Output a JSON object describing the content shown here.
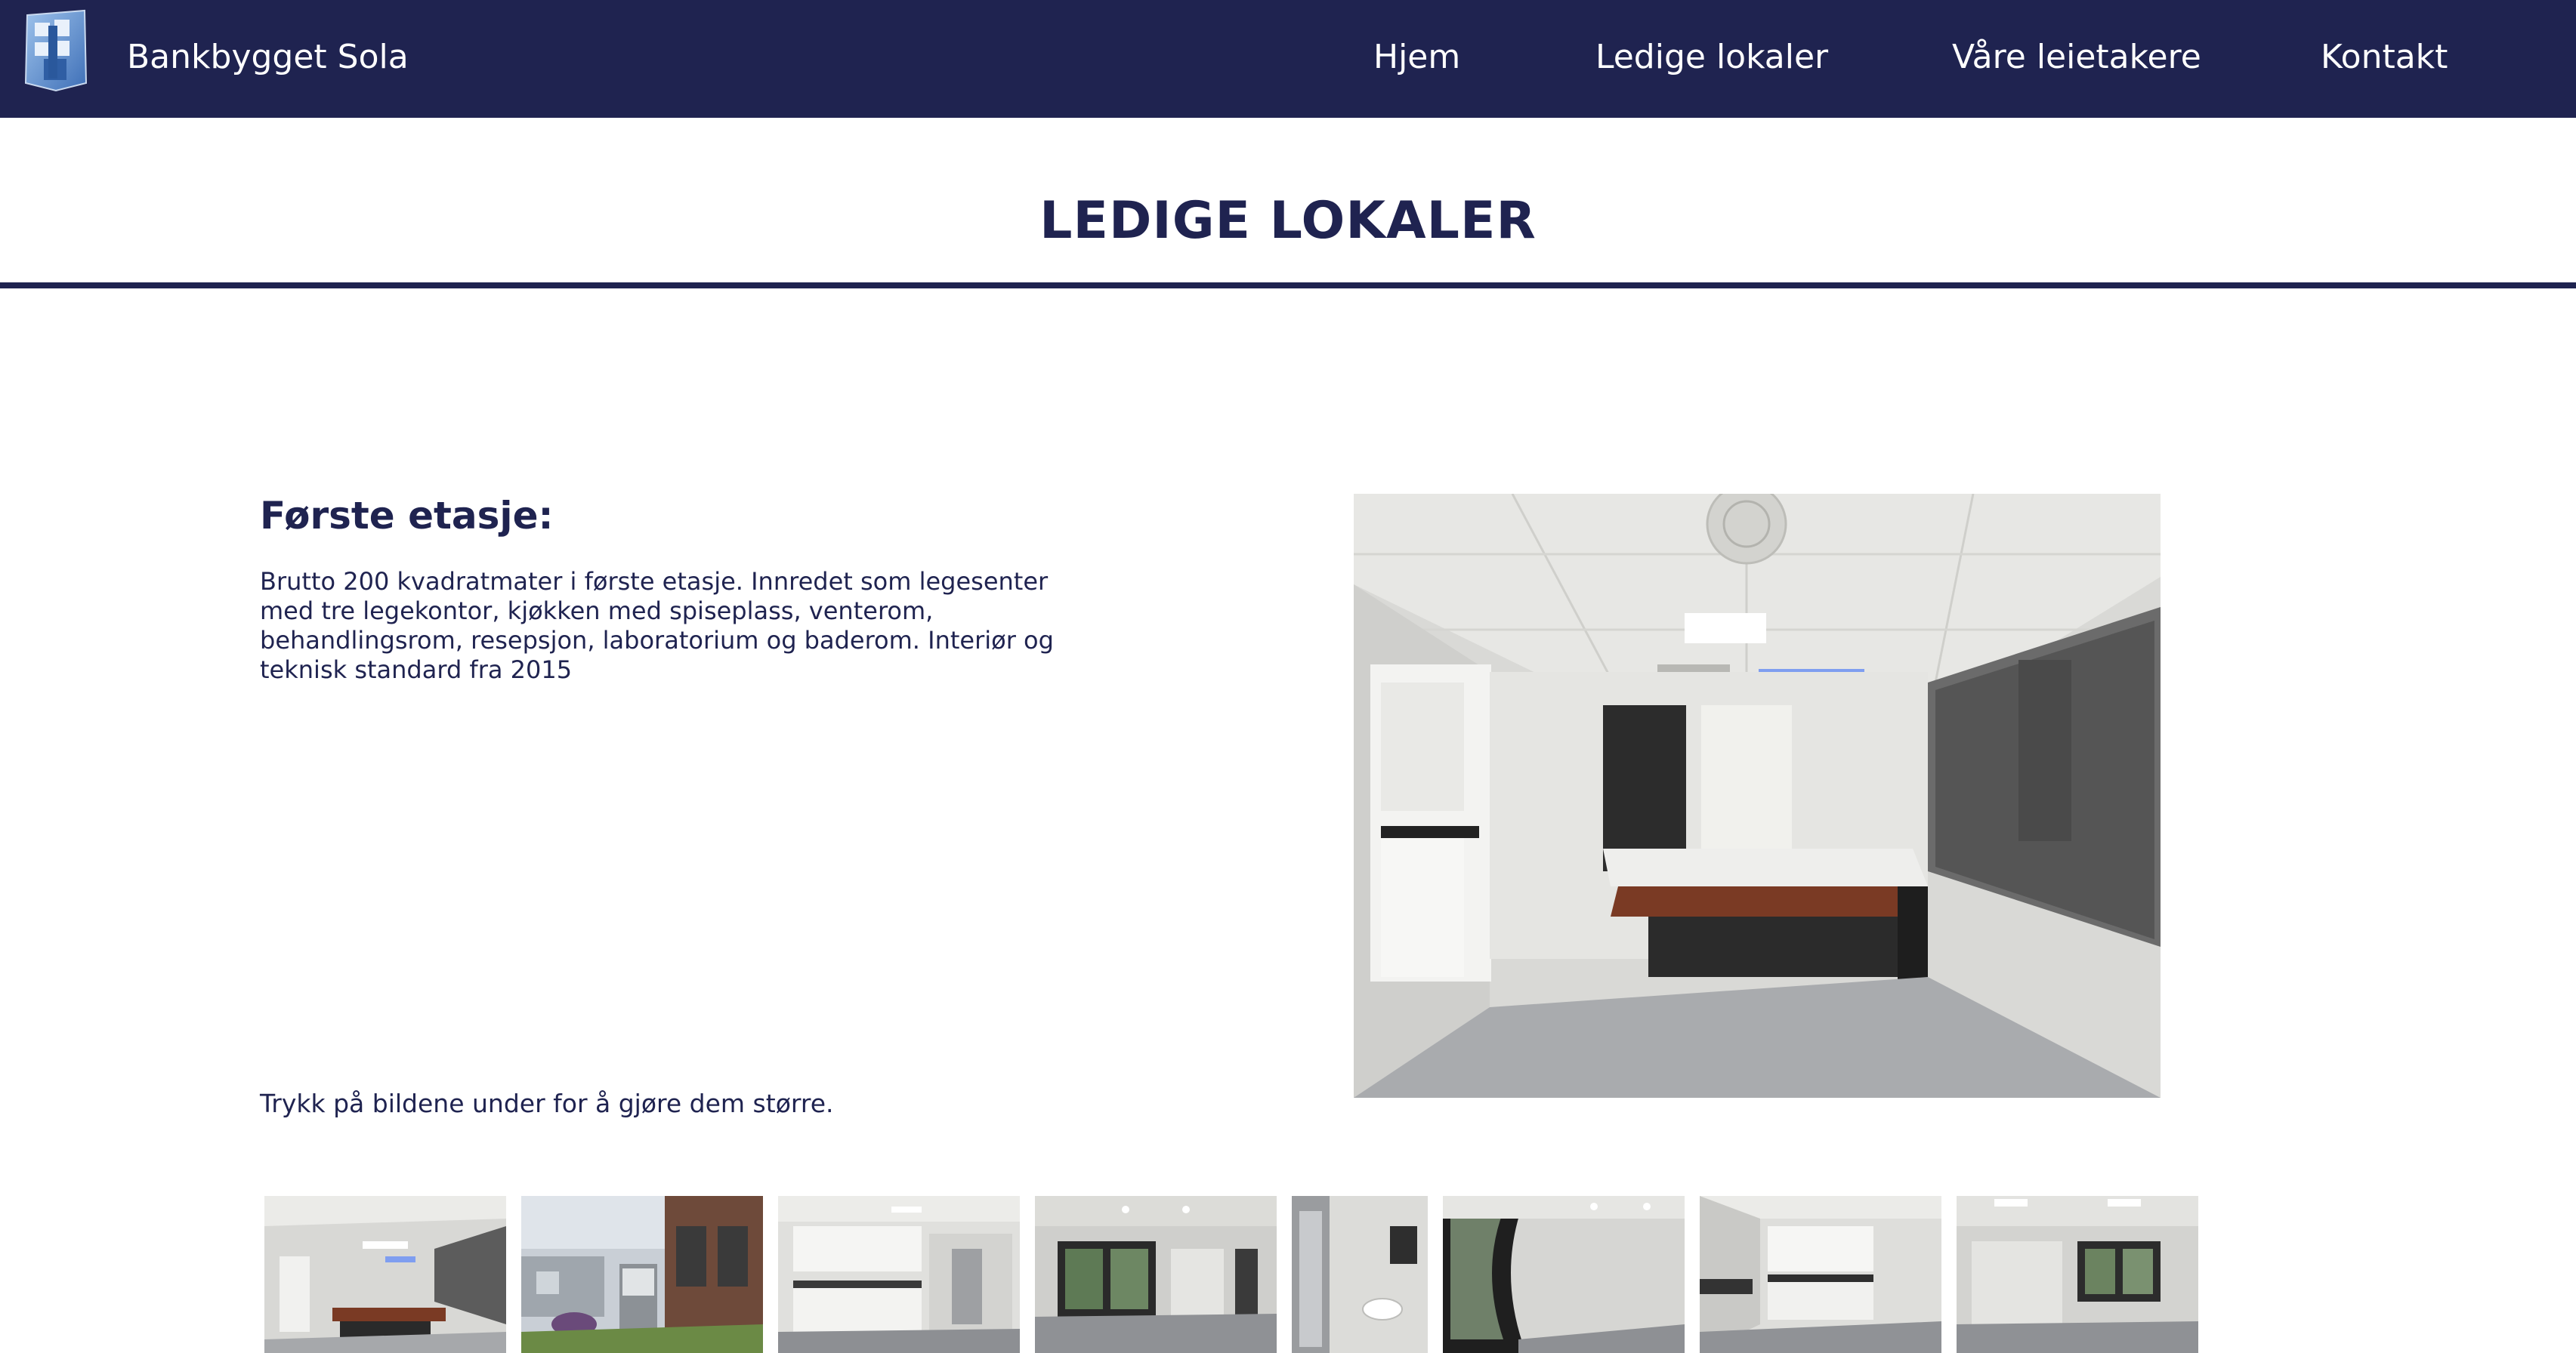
{
  "site": {
    "brand": "Bankbygget Sola"
  },
  "nav": {
    "items": [
      {
        "label": "Hjem"
      },
      {
        "label": "Ledige lokaler"
      },
      {
        "label": "Våre leietakere"
      },
      {
        "label": "Kontakt"
      }
    ]
  },
  "page": {
    "title": "LEDIGE LOKALER"
  },
  "section": {
    "heading": "Første etasje:",
    "description": "Brutto 200 kvadratmater i første etasje. Innredet som legesenter med tre legekontor, kjøkken med spiseplass, venterom, behandlingsrom, resepsjon, laboratorium og baderom. Interiør og teknisk standard fra 2015",
    "hint": "Trykk på bildene under for å gjøre dem større."
  },
  "colors": {
    "navy": "#1f2350",
    "white": "#ffffff"
  },
  "gallery": {
    "thumbnails": [
      {
        "subject": "reception-desk"
      },
      {
        "subject": "building-exterior"
      },
      {
        "subject": "kitchen"
      },
      {
        "subject": "empty-room-windows"
      },
      {
        "subject": "bathroom"
      },
      {
        "subject": "curved-window-room"
      },
      {
        "subject": "kitchenette"
      },
      {
        "subject": "office-room"
      }
    ]
  }
}
